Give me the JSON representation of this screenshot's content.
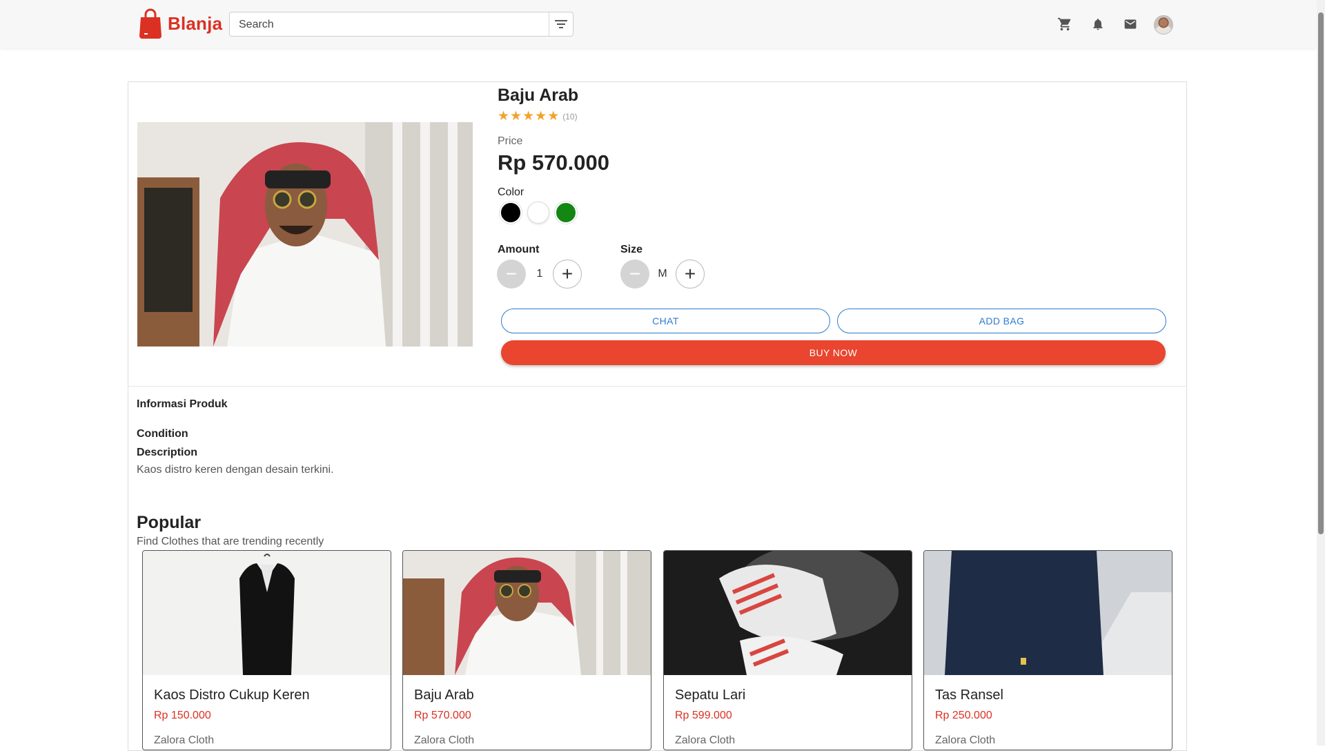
{
  "header": {
    "brand": "Blanja",
    "search_placeholder": "Search",
    "icons": [
      "shopping-bag-icon",
      "filter-icon",
      "cart-icon",
      "bell-icon",
      "mail-icon",
      "avatar"
    ]
  },
  "product": {
    "name": "Baju Arab",
    "rating_count": "(10)",
    "stars": 5,
    "price_label": "Price",
    "price": "Rp 570.000",
    "color_label": "Color",
    "colors": [
      "#000000",
      "#ffffff",
      "#138613"
    ],
    "amount_label": "Amount",
    "amount_value": "1",
    "size_label": "Size",
    "size_value": "M",
    "chat_label": "CHAT",
    "add_bag_label": "ADD BAG",
    "buy_label": "BUY NOW"
  },
  "info": {
    "title": "Informasi Produk",
    "condition_label": "Condition",
    "description_label": "Description",
    "description": "Kaos distro keren dengan desain terkini."
  },
  "popular": {
    "title": "Popular",
    "subtitle": "Find Clothes that are trending recently",
    "items": [
      {
        "name": "Kaos Distro Cukup Keren",
        "price": "Rp 150.000",
        "store": "Zalora Cloth"
      },
      {
        "name": "Baju Arab",
        "price": "Rp 570.000",
        "store": "Zalora Cloth"
      },
      {
        "name": "Sepatu Lari",
        "price": "Rp 599.000",
        "store": "Zalora Cloth"
      },
      {
        "name": "Tas Ransel",
        "price": "Rp 250.000",
        "store": "Zalora Cloth"
      }
    ]
  },
  "colors": {
    "brand": "#db3022",
    "buy_button": "#e9452f",
    "outline_button": "#2c7bd0",
    "star": "#f2a22a"
  }
}
